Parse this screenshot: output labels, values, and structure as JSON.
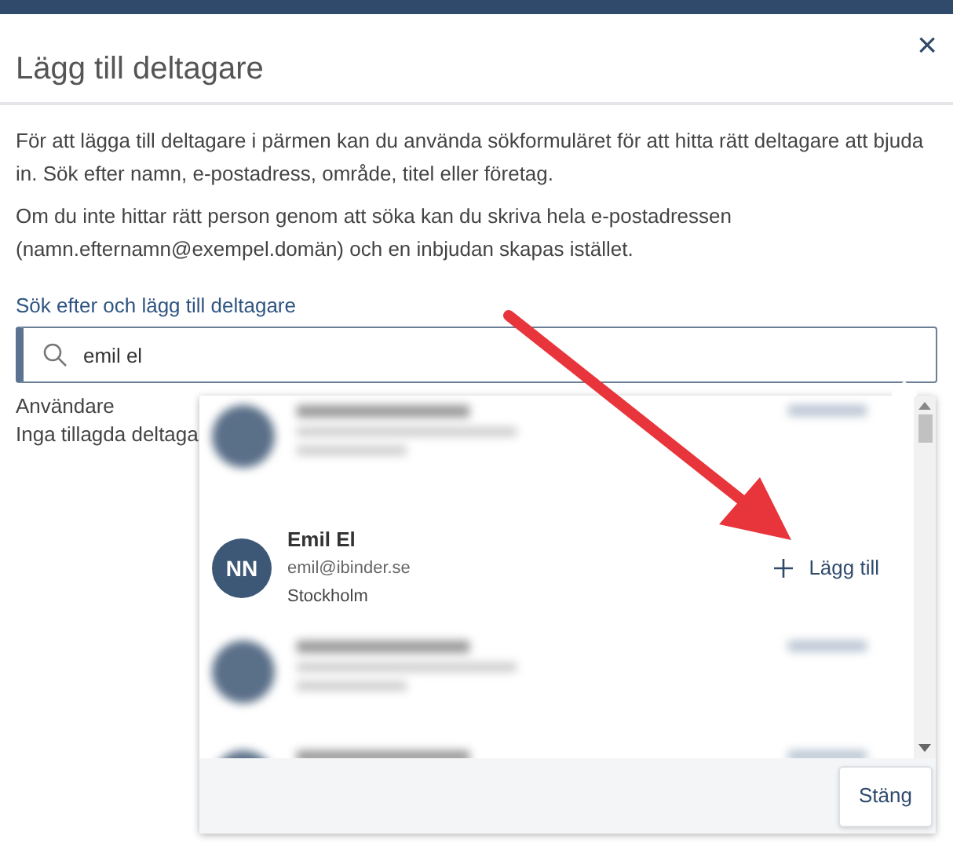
{
  "dialog": {
    "title": "Lägg till deltagare",
    "close": "×"
  },
  "intro": [
    "För att lägga till deltagare i pärmen kan du använda sökformuläret för att hitta rätt deltagare att bjuda in. Sök efter namn, e-postadress, område, titel eller företag.",
    "Om du inte hittar rätt person genom att söka kan du skriva hela e-postadressen (namn.efternamn@exempel.domän) och en inbjudan skapas istället."
  ],
  "search": {
    "label": "Sök efter och lägg till deltagare",
    "value": "emil el"
  },
  "users": {
    "heading": "Användare",
    "empty": "Inga tillagda deltaga"
  },
  "results": [
    {
      "kind": "blurred"
    },
    {
      "kind": "person",
      "initials": "NN",
      "name": "Emil El",
      "email": "emil@ibinder.se",
      "location": "Stockholm",
      "action": "Lägg till"
    },
    {
      "kind": "blurred"
    },
    {
      "kind": "blurred"
    }
  ],
  "close_button": "Stäng"
}
